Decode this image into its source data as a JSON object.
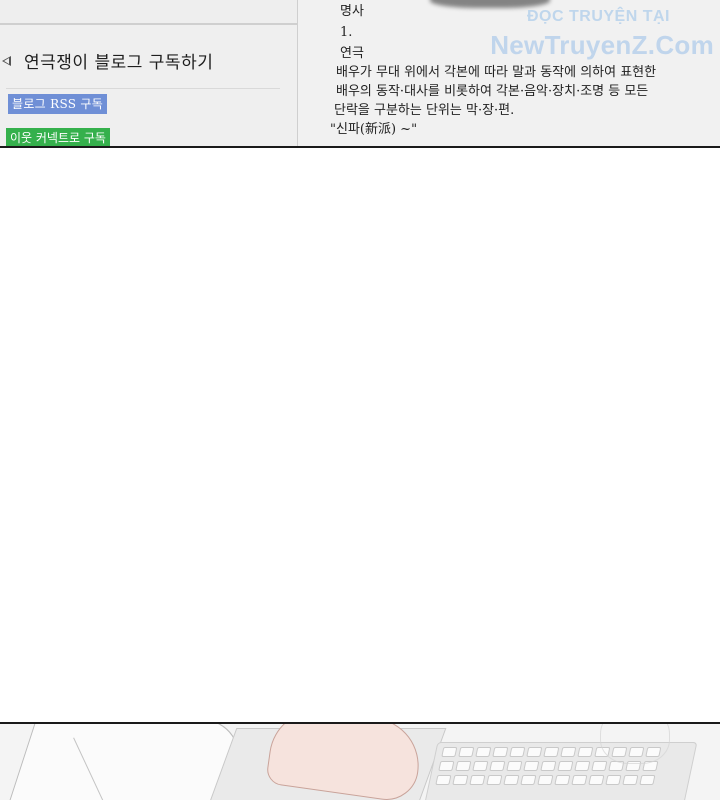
{
  "left_panel": {
    "subscribe_label": "연극쟁이 블로그 구독하기",
    "rss_badge": "블로그 RSS 구독",
    "neighbor_badge": "이웃 커넥트로 구독"
  },
  "dictionary": {
    "pos": "명사",
    "number": "1.",
    "word": "연극",
    "definition_line1": "배우가 무대 위에서 각본에 따라 말과 동작에 의하여 표현한",
    "definition_line2": "배우의 동작·대사를 비롯하여 각본·음악·장치·조명 등 모든",
    "definition_line3": "단락을 구분하는 단위는 막·장·편.",
    "example": "\"신파(新派) ~\""
  },
  "watermark": {
    "top": "ĐỌC TRUYỆN TẠI",
    "main": "NewTruyenZ.Com"
  },
  "icons": {
    "bullet": "triangle-bullet-icon"
  }
}
